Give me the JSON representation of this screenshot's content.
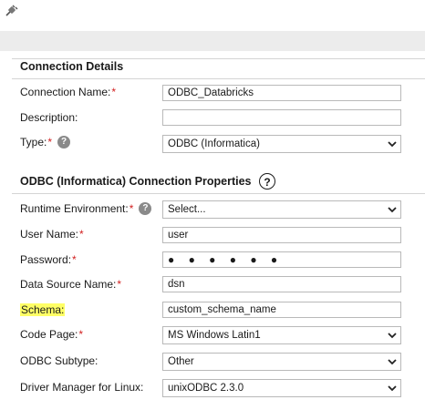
{
  "toolbar": {
    "icon": "plug-icon"
  },
  "sections": {
    "connection_details": "Connection Details",
    "odbc_properties": "ODBC (Informatica) Connection Properties"
  },
  "fields": {
    "connection_name": {
      "label": "Connection Name:",
      "required": "*",
      "value": "ODBC_Databricks"
    },
    "description": {
      "label": "Description:",
      "value": ""
    },
    "type": {
      "label": "Type:",
      "required": "*",
      "value": "ODBC (Informatica)"
    },
    "runtime_environment": {
      "label": "Runtime Environment:",
      "required": "*",
      "value": "Select..."
    },
    "user_name": {
      "label": "User Name:",
      "required": "*",
      "value": "user"
    },
    "password": {
      "label": "Password:",
      "required": "*",
      "value": "● ● ● ● ● ●"
    },
    "data_source_name": {
      "label": "Data Source Name:",
      "required": "*",
      "value": "dsn"
    },
    "schema": {
      "label": "Schema:",
      "value": "custom_schema_name"
    },
    "code_page": {
      "label": "Code Page:",
      "required": "*",
      "value": "MS Windows Latin1"
    },
    "odbc_subtype": {
      "label": "ODBC Subtype:",
      "value": "Other"
    },
    "driver_manager": {
      "label": "Driver Manager for Linux:",
      "value": "unixODBC 2.3.0"
    }
  },
  "help_symbol": "?",
  "colors": {
    "required": "#d21f1f",
    "highlight": "#ffff66",
    "band": "#ececec"
  }
}
